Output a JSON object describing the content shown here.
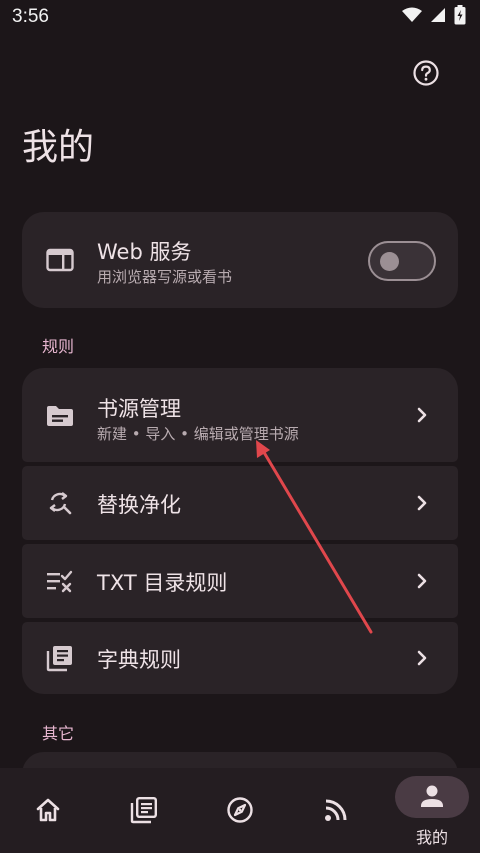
{
  "status": {
    "time": "3:56"
  },
  "header": {
    "title": "我的",
    "help_icon": "help-circle-icon"
  },
  "web_service": {
    "title": "Web 服务",
    "subtitle": "用浏览器写源或看书",
    "enabled": false
  },
  "sections": {
    "rules_label": "规则",
    "other_label": "其它"
  },
  "rules": [
    {
      "title": "书源管理",
      "subtitle": "新建 • 导入 • 编辑或管理书源",
      "icon": "folder-icon"
    },
    {
      "title": "替换净化",
      "icon": "find-replace-icon"
    },
    {
      "title": "TXT 目录规则",
      "icon": "toc-icon"
    },
    {
      "title": "字典规则",
      "icon": "dictionary-icon"
    }
  ],
  "bottom_nav": {
    "items": [
      {
        "icon": "home-icon"
      },
      {
        "icon": "library-icon"
      },
      {
        "icon": "compass-icon"
      },
      {
        "icon": "rss-icon"
      },
      {
        "icon": "profile-icon",
        "label": "我的",
        "active": true
      }
    ]
  },
  "colors": {
    "background": "#1c1619",
    "card": "#2a2327",
    "accent_label": "#e7b6d0",
    "annotation_arrow": "#e0474c"
  }
}
